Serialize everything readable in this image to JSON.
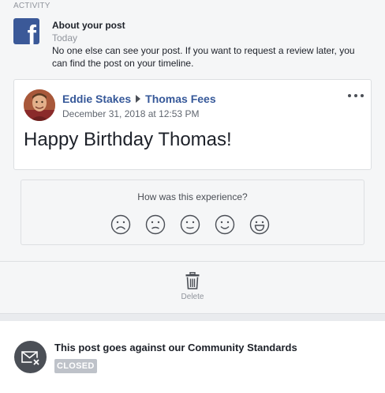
{
  "section": {
    "label": "ACTIVITY"
  },
  "notice": {
    "logo": "facebook-logo",
    "title": "About your post",
    "time": "Today",
    "body": "No one else can see your post. If you want to request a review later, you can find the post on your timeline."
  },
  "post": {
    "author": "Eddie Stakes",
    "recipient": "Thomas Fees",
    "date": "December 31, 2018 at 12:53 PM",
    "text": "Happy Birthday Thomas!",
    "more_icon": "more-options-icon"
  },
  "feedback": {
    "question": "How was this experience?",
    "faces": [
      "very-sad-face-icon",
      "sad-face-icon",
      "neutral-face-icon",
      "happy-face-icon",
      "very-happy-face-icon"
    ]
  },
  "actions": {
    "delete_label": "Delete",
    "delete_icon": "trash-icon"
  },
  "status": {
    "icon": "envelope-closed-icon",
    "title": "This post goes against our Community Standards",
    "badge": "CLOSED"
  },
  "colors": {
    "brand": "#3b5998",
    "link": "#365899",
    "muted": "#90949c",
    "badge": "#bec2c9"
  }
}
